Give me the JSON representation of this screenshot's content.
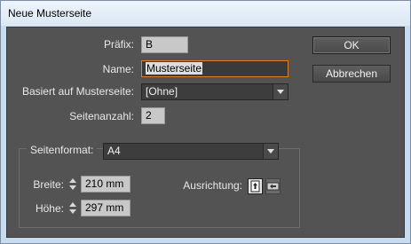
{
  "window": {
    "title": "Neue Musterseite"
  },
  "form": {
    "prefix_label": "Präfix:",
    "prefix_value": "B",
    "name_label": "Name:",
    "name_value": "Musterseite",
    "based_on_label": "Basiert auf Musterseite:",
    "based_on_value": "[Ohne]",
    "page_count_label": "Seitenanzahl:",
    "page_count_value": "2"
  },
  "page_format": {
    "label": "Seitenformat:",
    "value": "A4",
    "width_label": "Breite:",
    "width_value": "210 mm",
    "height_label": "Höhe:",
    "height_value": "297 mm",
    "orientation_label": "Ausrichtung:"
  },
  "buttons": {
    "ok": "OK",
    "cancel": "Abbrechen"
  },
  "icons": [
    "up-down-spin-icon",
    "portrait-orientation-icon",
    "landscape-orientation-icon",
    "chevron-down-icon"
  ]
}
